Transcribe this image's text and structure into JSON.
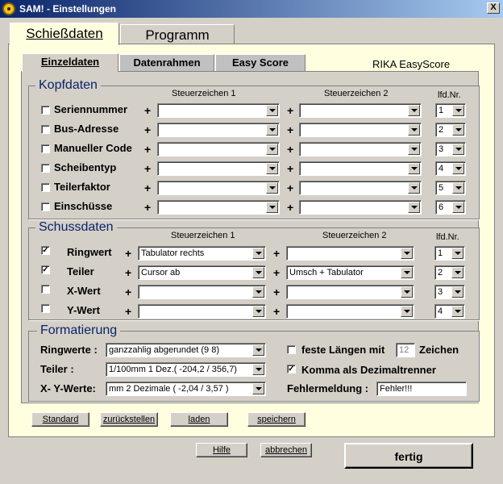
{
  "window": {
    "title": "SAM! - Einstellungen",
    "close_glyph": "X"
  },
  "tabs": [
    {
      "label": "Schießdaten",
      "active": true
    },
    {
      "label": "Programm",
      "active": false
    }
  ],
  "subtabs": [
    {
      "label": "Einzeldaten",
      "active": true
    },
    {
      "label": "Datenrahmen",
      "active": false
    },
    {
      "label": "Easy Score",
      "active": false
    }
  ],
  "rika_label": "RIKA EasyScore",
  "kopfdaten": {
    "title": "Kopfdaten",
    "col1": "Steuerzeichen 1",
    "col2": "Steuerzeichen 2",
    "col3": "lfd.Nr.",
    "plus": "+",
    "rows": [
      {
        "label": "Seriennummer",
        "checked": false,
        "sz1": "",
        "sz2": "",
        "nr": "1"
      },
      {
        "label": "Bus-Adresse",
        "checked": false,
        "sz1": "",
        "sz2": "",
        "nr": "2"
      },
      {
        "label": "Manueller Code",
        "checked": false,
        "sz1": "",
        "sz2": "",
        "nr": "3"
      },
      {
        "label": "Scheibentyp",
        "checked": false,
        "sz1": "",
        "sz2": "",
        "nr": "4"
      },
      {
        "label": "Teilerfaktor",
        "checked": false,
        "sz1": "",
        "sz2": "",
        "nr": "5"
      },
      {
        "label": "Einschüsse",
        "checked": false,
        "sz1": "",
        "sz2": "",
        "nr": "6"
      }
    ]
  },
  "schussdaten": {
    "title": "Schussdaten",
    "col1": "Steuerzeichen 1",
    "col2": "Steuerzeichen 2",
    "col3": "lfd.Nr.",
    "plus": "+",
    "rows": [
      {
        "label": "Ringwert",
        "checked": true,
        "sz1": "Tabulator rechts",
        "sz2": "",
        "nr": "1"
      },
      {
        "label": "Teiler",
        "checked": true,
        "sz1": "Cursor ab",
        "sz2": "Umsch + Tabulator",
        "nr": "2"
      },
      {
        "label": "X-Wert",
        "checked": false,
        "sz1": "",
        "sz2": "",
        "nr": "3"
      },
      {
        "label": "Y-Wert",
        "checked": false,
        "sz1": "",
        "sz2": "",
        "nr": "4"
      }
    ]
  },
  "formatierung": {
    "title": "Formatierung",
    "ringwerte_label": "Ringwerte :",
    "ringwerte_value": "ganzzahlig abgerundet (9  8)",
    "teiler_label": "Teiler :",
    "teiler_value": "1/100mm 1 Dez.( -204,2 / 356,7)",
    "xy_label": "X- Y-Werte:",
    "xy_value": "mm 2 Dezimale     ( -2,04 / 3,57 )",
    "feste_label": "feste Längen mit",
    "feste_checked": false,
    "feste_value": "12",
    "zeichen_label": "Zeichen",
    "komma_label": "Komma als Dezimaltrenner",
    "komma_checked": true,
    "fehler_label": "Fehlermeldung :",
    "fehler_value": "Fehler!!!"
  },
  "buttons": {
    "standard": "Standard",
    "zurueck": "zurückstellen",
    "laden": "laden",
    "speichern": "speichern",
    "hilfe": "Hilfe",
    "abbrechen": "abbrechen",
    "fertig": "fertig"
  },
  "check_glyph": "✓"
}
